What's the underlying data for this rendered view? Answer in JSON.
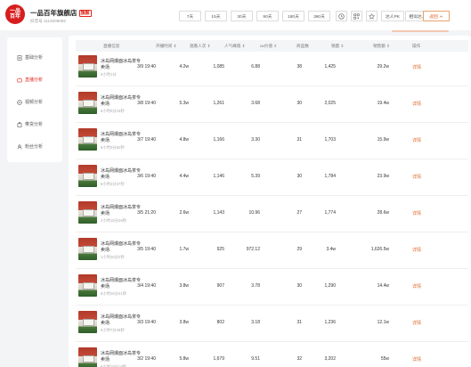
{
  "shop": {
    "logo_line1": "一品",
    "logo_line2": "百年",
    "name": "一品百年旗舰店",
    "badge": "旗舰",
    "id_text": "抖音号 1113206082"
  },
  "header": {
    "day_tabs": [
      "7天",
      "15天",
      "30天",
      "90天",
      "180天",
      "360天"
    ],
    "compare_label": "达人PK",
    "similar_label": "相似达人",
    "back_label": "返回"
  },
  "sidebar": {
    "items": [
      {
        "label": "基础分析",
        "icon": "document-icon"
      },
      {
        "label": "直播分析",
        "icon": "live-icon"
      },
      {
        "label": "视频分析",
        "icon": "video-icon"
      },
      {
        "label": "带货分析",
        "icon": "cart-icon"
      },
      {
        "label": "粉丝分析",
        "icon": "user-icon"
      }
    ],
    "active_index": 1
  },
  "table": {
    "headers": [
      "直播信息",
      "开播时间 ⇕",
      "观看人次 ⇕",
      "人气峰值 ⇕",
      "uv价值 ⇕",
      "商品数",
      "销量 ⇕",
      "销售额 ⇕",
      "操作"
    ],
    "rows": [
      {
        "title": "冰岛网爆面冰岛茶专卖场",
        "duration": "6小时1分",
        "time": "3/9 19:40",
        "views": "4.2w",
        "peak": "1,085",
        "uv": "6.88",
        "goods": "38",
        "sales": "1,425",
        "revenue": "29.2w",
        "action": "详情"
      },
      {
        "title": "冰岛网爆面冰岛茶专卖场",
        "duration": "6小时5分15秒",
        "time": "3/8 19:40",
        "views": "5.3w",
        "peak": "1,261",
        "uv": "3.68",
        "goods": "30",
        "sales": "2,025",
        "revenue": "19.4w",
        "action": "详情"
      },
      {
        "title": "冰岛网爆面冰岛茶专卖场",
        "duration": "6小时3分52秒",
        "time": "3/7 19:40",
        "views": "4.8w",
        "peak": "1,166",
        "uv": "3.30",
        "goods": "31",
        "sales": "1,703",
        "revenue": "15.9w",
        "action": "详情"
      },
      {
        "title": "冰岛网爆面冰岛茶专卖场",
        "duration": "6小时2分37秒",
        "time": "3/6 19:40",
        "views": "4.4w",
        "peak": "1,146",
        "uv": "5.39",
        "goods": "30",
        "sales": "1,784",
        "revenue": "23.9w",
        "action": "详情"
      },
      {
        "title": "冰岛网爆面冰岛茶专卖场",
        "duration": "2小时15分26秒",
        "time": "3/5 21:20",
        "views": "2.6w",
        "peak": "1,143",
        "uv": "10.96",
        "goods": "27",
        "sales": "1,774",
        "revenue": "28.6w",
        "action": "详情"
      },
      {
        "title": "冰岛网爆面冰岛茶专卖场",
        "duration": "1小时26分2秒",
        "time": "3/5 19:40",
        "views": "1.7w",
        "peak": "925",
        "uv": "972.12",
        "goods": "29",
        "sales": "3.4w",
        "revenue": "1,626.5w",
        "action": "详情"
      },
      {
        "title": "冰岛网爆面冰岛茶专卖场",
        "duration": "6小时26分41秒",
        "time": "3/4 19:40",
        "views": "3.8w",
        "peak": "907",
        "uv": "3.78",
        "goods": "30",
        "sales": "1,290",
        "revenue": "14.4w",
        "action": "详情"
      },
      {
        "title": "冰岛网爆面冰岛茶专卖场",
        "duration": "6小时7分48秒",
        "time": "3/3 19:40",
        "views": "3.8w",
        "peak": "802",
        "uv": "3.18",
        "goods": "31",
        "sales": "1,236",
        "revenue": "12.1w",
        "action": "详情"
      },
      {
        "title": "冰岛网爆面冰岛茶专卖场",
        "duration": "6小时18分19秒",
        "time": "3/2 19:40",
        "views": "5.8w",
        "peak": "1,679",
        "uv": "9.51",
        "goods": "32",
        "sales": "3,202",
        "revenue": "55w",
        "action": "详情"
      }
    ]
  },
  "colors": {
    "accent": "#e2231a",
    "link": "#e0682b"
  }
}
